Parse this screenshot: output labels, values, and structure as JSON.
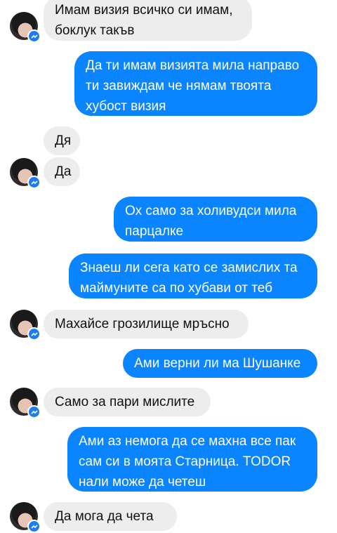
{
  "messages": [
    {
      "direction": "incoming",
      "text": "Имам визия всичко си имам,\nбоклук такъв",
      "avatar": true
    },
    {
      "direction": "outgoing",
      "text": "Да ти имам визията мила направо\nти завиждам  че нямам твоята\nхубост визия"
    },
    {
      "direction": "incoming",
      "text": "Дя",
      "avatar": false
    },
    {
      "direction": "incoming",
      "text": "Да",
      "avatar": true
    },
    {
      "direction": "outgoing",
      "text": "Ох само за холивудси  мила\nпарцалке"
    },
    {
      "direction": "outgoing",
      "text": "Знаеш ли сега като се замислих та\nмаймуните са по хубави от теб"
    },
    {
      "direction": "incoming",
      "text": "Махайсе грозилище мръсно",
      "avatar": true
    },
    {
      "direction": "outgoing",
      "text": "Ами верни ли ма Шушанке"
    },
    {
      "direction": "incoming",
      "text": "Само за пари мислите",
      "avatar": true
    },
    {
      "direction": "outgoing",
      "text": "Ами аз немога да се махна все пак\nсам си в моята Старница. TODOR\nнали може да четеш"
    },
    {
      "direction": "incoming",
      "text": "Да мога да чета",
      "avatar": true
    }
  ],
  "colors": {
    "outgoing_bubble": "#0a84ff",
    "incoming_bubble": "#ededed",
    "badge": "#1c7cf2"
  },
  "icons": {
    "avatar": "contact-avatar",
    "badge": "messenger-badge-icon"
  }
}
